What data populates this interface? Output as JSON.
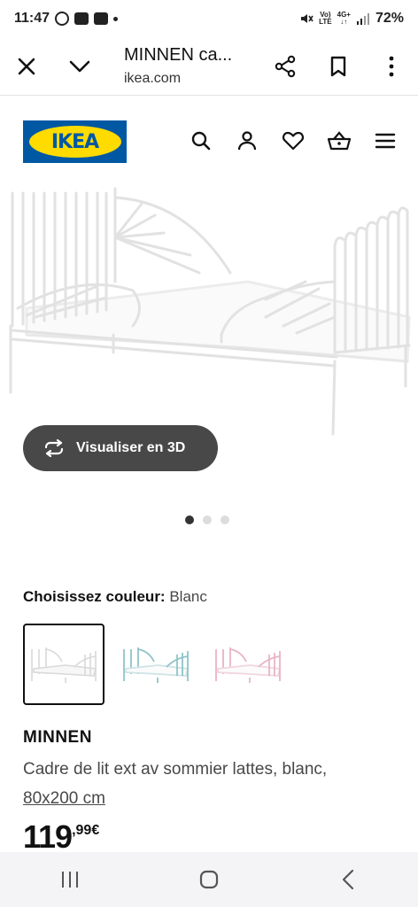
{
  "status": {
    "time": "11:47",
    "battery": "72%",
    "network_top": "Vo)",
    "network_bottom": "LTE",
    "signal_top": "4G+"
  },
  "browser": {
    "title": "MINNEN ca...",
    "url": "ikea.com"
  },
  "header": {
    "logo_text": "IKEA",
    "brand_blue": "#0058a3",
    "brand_yellow": "#ffdb00"
  },
  "hero": {
    "visualize_label": "Visualiser en 3D",
    "carousel": {
      "count": 3,
      "active": 0
    }
  },
  "color_picker": {
    "label": "Choisissez couleur:",
    "value": "Blanc",
    "options": [
      {
        "name": "white",
        "color": "#ffffff"
      },
      {
        "name": "blue",
        "color": "#8fc4c9"
      },
      {
        "name": "pink",
        "color": "#e9b4c4"
      }
    ]
  },
  "product": {
    "name": "MINNEN",
    "description": "Cadre de lit ext av sommier lattes, blanc,",
    "size": "80x200 cm",
    "price_int": "119",
    "price_dec": ",99€"
  }
}
